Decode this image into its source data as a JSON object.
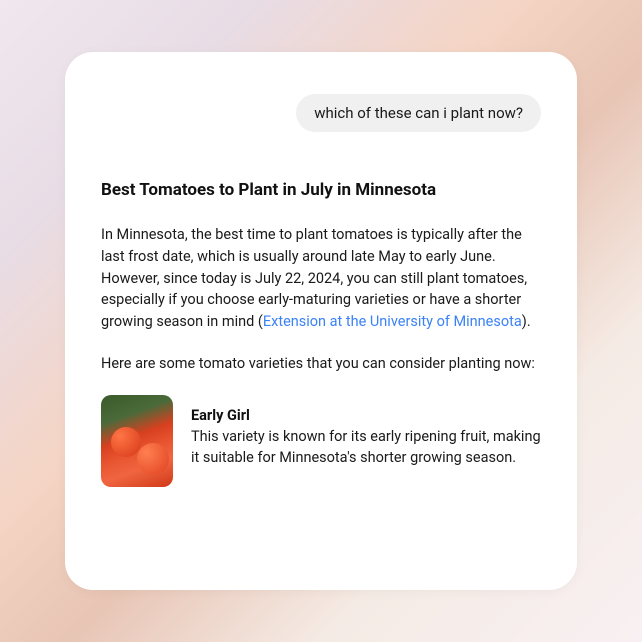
{
  "user_message": "which of these can i plant now?",
  "response": {
    "title": "Best Tomatoes to Plant in July in Minnesota",
    "intro_part1": "In Minnesota, the best time to plant tomatoes is typically after the last frost date, which is usually around late May to early June. However, since today is July 22, 2024, you can still plant tomatoes, especially if you choose early-maturing varieties or have a shorter growing season in mind (",
    "intro_link": "Extension at the University of Minnesota",
    "intro_part2": ").",
    "lead_in": "Here are some tomato varieties that you can consider planting now:",
    "varieties": [
      {
        "name": "Early Girl",
        "description": "This variety is known for its early ripening fruit, making it suitable for Minnesota's shorter growing season."
      }
    ]
  }
}
